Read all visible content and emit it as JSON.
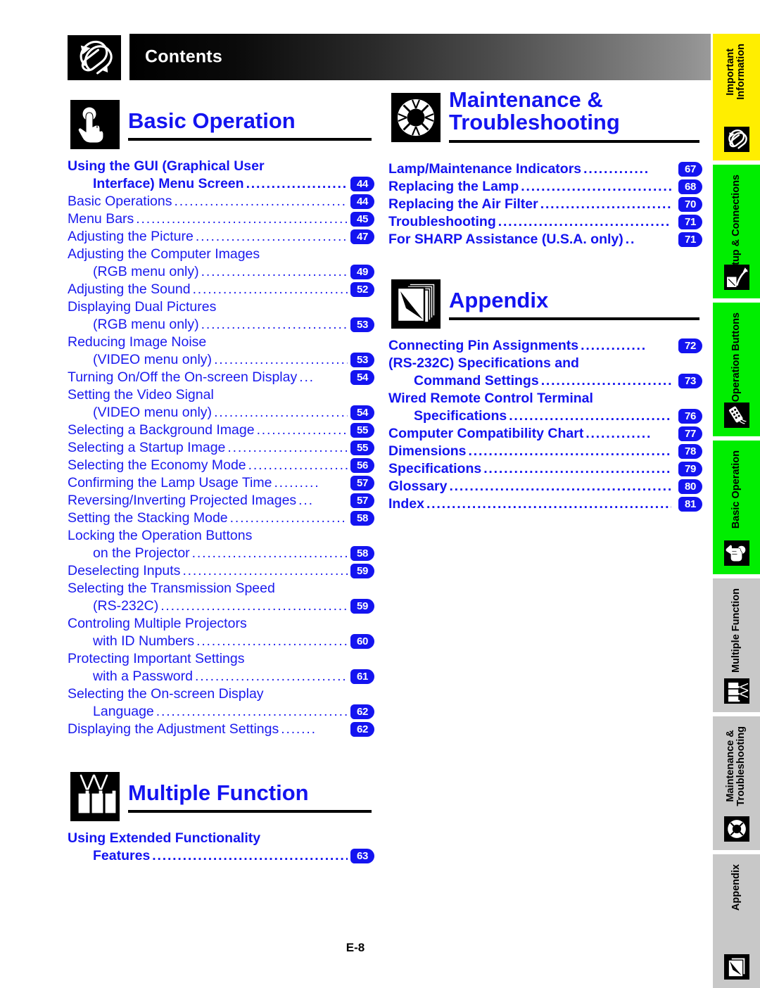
{
  "header": {
    "title": "Contents",
    "icon": "paperclip-icon"
  },
  "footer": {
    "page_label": "E-8"
  },
  "sections": [
    {
      "id": "basic-operation",
      "title_lines": [
        "Basic Operation"
      ],
      "icon": "pressing-hand-icon",
      "column": "left",
      "entries": [
        {
          "text": "Using the GUI (Graphical User",
          "page": "",
          "bold": true,
          "indent": false,
          "dots": false
        },
        {
          "text": "Interface) Menu Screen",
          "page": "44",
          "bold": true,
          "indent": true,
          "dots": true
        },
        {
          "text": "Basic Operations",
          "page": "44",
          "bold": false,
          "indent": false,
          "dots": true
        },
        {
          "text": "Menu Bars",
          "page": "45",
          "bold": false,
          "indent": false,
          "dots": true
        },
        {
          "text": "Adjusting the Picture",
          "page": "47",
          "bold": false,
          "indent": false,
          "dots": true
        },
        {
          "text": "Adjusting the Computer Images",
          "page": "",
          "bold": false,
          "indent": false,
          "dots": false
        },
        {
          "text": "(RGB menu only)",
          "page": "49",
          "bold": false,
          "indent": true,
          "dots": true
        },
        {
          "text": "Adjusting the Sound",
          "page": "52",
          "bold": false,
          "indent": false,
          "dots": true
        },
        {
          "text": "Displaying Dual Pictures",
          "page": "",
          "bold": false,
          "indent": false,
          "dots": false
        },
        {
          "text": "(RGB menu only)",
          "page": "53",
          "bold": false,
          "indent": true,
          "dots": true
        },
        {
          "text": "Reducing Image Noise",
          "page": "",
          "bold": false,
          "indent": false,
          "dots": false
        },
        {
          "text": "(VIDEO menu only)",
          "page": "53",
          "bold": false,
          "indent": true,
          "dots": true
        },
        {
          "text": "Turning On/Off the On-screen Display",
          "page": "54",
          "bold": false,
          "indent": false,
          "dots": true
        },
        {
          "text": "Setting the Video Signal",
          "page": "",
          "bold": false,
          "indent": false,
          "dots": false
        },
        {
          "text": "(VIDEO menu only)",
          "page": "54",
          "bold": false,
          "indent": true,
          "dots": true
        },
        {
          "text": "Selecting a Background Image",
          "page": "55",
          "bold": false,
          "indent": false,
          "dots": true
        },
        {
          "text": "Selecting a Startup Image",
          "page": "55",
          "bold": false,
          "indent": false,
          "dots": true
        },
        {
          "text": "Selecting the Economy Mode",
          "page": "56",
          "bold": false,
          "indent": false,
          "dots": true
        },
        {
          "text": "Confirming the Lamp Usage Time",
          "page": "57",
          "bold": false,
          "indent": false,
          "dots": true
        },
        {
          "text": "Reversing/Inverting Projected Images",
          "page": "57",
          "bold": false,
          "indent": false,
          "dots": true
        },
        {
          "text": "Setting the Stacking Mode",
          "page": "58",
          "bold": false,
          "indent": false,
          "dots": true
        },
        {
          "text": "Locking the Operation Buttons",
          "page": "",
          "bold": false,
          "indent": false,
          "dots": false
        },
        {
          "text": "on the Projector",
          "page": "58",
          "bold": false,
          "indent": true,
          "dots": true
        },
        {
          "text": "Deselecting Inputs",
          "page": "59",
          "bold": false,
          "indent": false,
          "dots": true
        },
        {
          "text": "Selecting the Transmission Speed",
          "page": "",
          "bold": false,
          "indent": false,
          "dots": false
        },
        {
          "text": "(RS-232C)",
          "page": "59",
          "bold": false,
          "indent": true,
          "dots": true
        },
        {
          "text": "Controling Multiple Projectors",
          "page": "",
          "bold": false,
          "indent": false,
          "dots": false
        },
        {
          "text": "with ID Numbers",
          "page": "60",
          "bold": false,
          "indent": true,
          "dots": true
        },
        {
          "text": "Protecting Important Settings",
          "page": "",
          "bold": false,
          "indent": false,
          "dots": false
        },
        {
          "text": "with a Password",
          "page": "61",
          "bold": false,
          "indent": true,
          "dots": true
        },
        {
          "text": "Selecting the On-screen Display",
          "page": "",
          "bold": false,
          "indent": false,
          "dots": false
        },
        {
          "text": "Language",
          "page": "62",
          "bold": false,
          "indent": true,
          "dots": true
        },
        {
          "text": "Displaying the Adjustment Settings",
          "page": "62",
          "bold": false,
          "indent": false,
          "dots": true
        }
      ]
    },
    {
      "id": "multiple-function",
      "title_lines": [
        "Multiple Function"
      ],
      "icon": "three-projectors-icon",
      "column": "left",
      "entries": [
        {
          "text": "Using Extended Functionality",
          "page": "",
          "bold": true,
          "indent": false,
          "dots": false
        },
        {
          "text": "Features",
          "page": "63",
          "bold": true,
          "indent": true,
          "dots": true
        }
      ]
    },
    {
      "id": "maintenance-troubleshooting",
      "title_lines": [
        "Maintenance &",
        "Troubleshooting"
      ],
      "icon": "life-ring-icon",
      "column": "right",
      "entries": [
        {
          "text": "Lamp/Maintenance Indicators",
          "page": "67",
          "bold": true,
          "indent": false,
          "dots": true
        },
        {
          "text": "Replacing the Lamp",
          "page": "68",
          "bold": true,
          "indent": false,
          "dots": true
        },
        {
          "text": "Replacing the Air Filter",
          "page": "70",
          "bold": true,
          "indent": false,
          "dots": true
        },
        {
          "text": "Troubleshooting",
          "page": "71",
          "bold": true,
          "indent": false,
          "dots": true
        },
        {
          "text": "For SHARP Assistance (U.S.A. only)",
          "page": "71",
          "bold": true,
          "indent": false,
          "dots": true
        }
      ]
    },
    {
      "id": "appendix",
      "title_lines": [
        "Appendix"
      ],
      "icon": "stacked-pages-icon",
      "column": "right",
      "entries": [
        {
          "text": "Connecting Pin Assignments",
          "page": "72",
          "bold": true,
          "indent": false,
          "dots": true
        },
        {
          "text": "(RS-232C) Specifications and",
          "page": "",
          "bold": true,
          "indent": false,
          "dots": false
        },
        {
          "text": "Command Settings",
          "page": "73",
          "bold": true,
          "indent": true,
          "dots": true
        },
        {
          "text": "Wired Remote Control Terminal",
          "page": "",
          "bold": true,
          "indent": false,
          "dots": false
        },
        {
          "text": "Specifications",
          "page": "76",
          "bold": true,
          "indent": true,
          "dots": true
        },
        {
          "text": "Computer Compatibility Chart",
          "page": "77",
          "bold": true,
          "indent": false,
          "dots": true
        },
        {
          "text": "Dimensions",
          "page": "78",
          "bold": true,
          "indent": false,
          "dots": true
        },
        {
          "text": "Specifications",
          "page": "79",
          "bold": true,
          "indent": false,
          "dots": true
        },
        {
          "text": "Glossary",
          "page": "80",
          "bold": true,
          "indent": false,
          "dots": true
        },
        {
          "text": "Index",
          "page": "81",
          "bold": true,
          "indent": false,
          "dots": true
        }
      ]
    }
  ],
  "sidebar": {
    "tabs": [
      {
        "label": "Important\nInformation",
        "color": "#ffee00",
        "icon": "paperclip-icon"
      },
      {
        "label": "Setup & Connections",
        "color": "#00ee00",
        "icon": "plug-cable-icon"
      },
      {
        "label": "Operation Buttons",
        "color": "#00ee00",
        "icon": "remote-control-icon"
      },
      {
        "label": "Basic Operation",
        "color": "#00ee00",
        "icon": "pressing-hand-icon"
      },
      {
        "label": "Multiple Function",
        "color": "#c8c8c8",
        "icon": "three-projectors-icon"
      },
      {
        "label": "Maintenance &\nTroubleshooting",
        "color": "#c8c8c8",
        "icon": "life-ring-icon"
      },
      {
        "label": "Appendix",
        "color": "#c8c8c8",
        "icon": "stacked-pages-icon"
      }
    ]
  },
  "colors": {
    "link_blue": "#1414f0",
    "tab_yellow": "#ffee00",
    "tab_green": "#00ee00",
    "tab_gray": "#c8c8c8"
  }
}
